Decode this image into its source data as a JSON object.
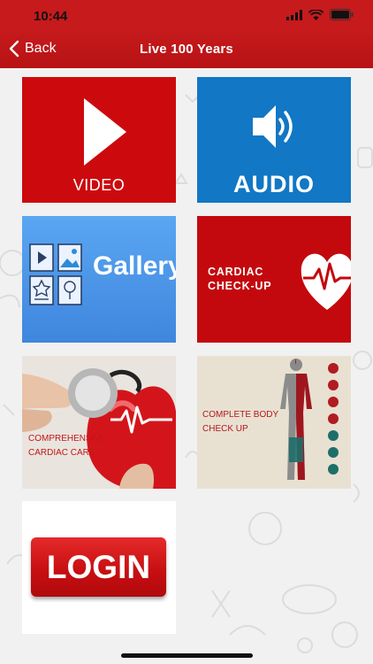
{
  "status_bar": {
    "time": "10:44"
  },
  "nav": {
    "back_label": "Back",
    "title": "Live 100 Years"
  },
  "tiles": [
    {
      "label": "VIDEO"
    },
    {
      "label": "AUDIO"
    },
    {
      "label": "Gallery"
    },
    {
      "label": "CARDIAC CHECK-UP"
    },
    {
      "label": "COMPREHENSIVE CARDIAC CARE"
    },
    {
      "label": "COMPLETE BODY CHECK UP"
    },
    {
      "label": "LOGIN"
    }
  ],
  "colors": {
    "brand_red": "#c61a1c",
    "audio_blue": "#1277c4",
    "gallery_blue": "#4a93e6"
  }
}
